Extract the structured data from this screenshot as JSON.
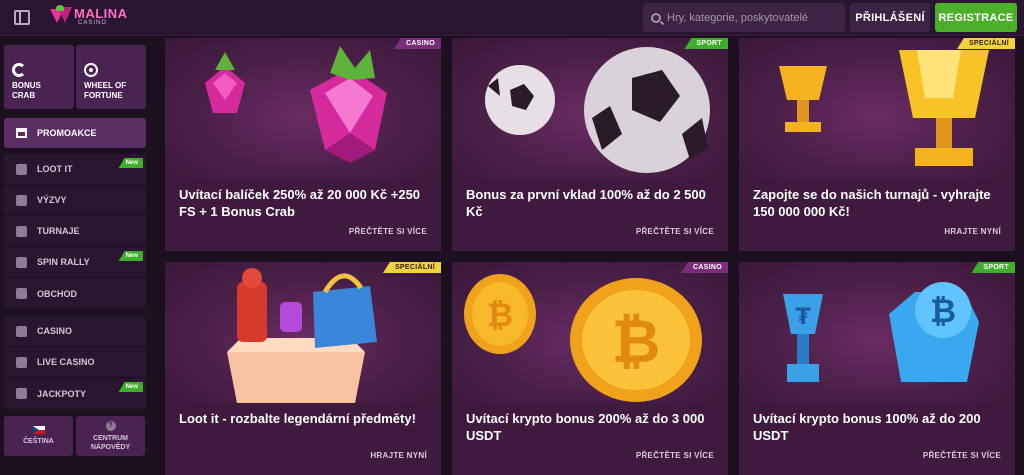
{
  "header": {
    "logo_main": "MALINA",
    "logo_sub": "CASINO",
    "search_placeholder": "Hry, kategorie, poskytovatelé",
    "login_label": "PŘIHLÁŠENÍ",
    "register_label": "REGISTRACE",
    "accent_color": "#4caf2a"
  },
  "sidebar": {
    "tiles": [
      {
        "label": "BONUS CRAB",
        "icon": "crab-icon"
      },
      {
        "label": "WHEEL OF FORTUNE",
        "icon": "wheel-icon"
      }
    ],
    "promo_label": "PROMOAKCE",
    "group1": [
      {
        "label": "LOOT IT",
        "icon": "chest-icon",
        "badge": "New"
      },
      {
        "label": "VÝZVY",
        "icon": "medal-icon",
        "badge": ""
      },
      {
        "label": "TURNAJE",
        "icon": "trophy-icon",
        "badge": ""
      },
      {
        "label": "SPIN RALLY",
        "icon": "flag-icon",
        "badge": "New"
      },
      {
        "label": "OBCHOD",
        "icon": "shop-icon",
        "badge": ""
      }
    ],
    "group2": [
      {
        "label": "CASINO",
        "icon": "cherry-icon",
        "badge": ""
      },
      {
        "label": "LIVE CASINO",
        "icon": "chip-icon",
        "badge": ""
      },
      {
        "label": "JACKPOTY",
        "icon": "coins-icon",
        "badge": "New"
      }
    ],
    "footer": {
      "language_label": "ČEŠTINA",
      "help_label": "CENTRUM NÁPOVĚDY",
      "help_glyph": "?"
    }
  },
  "cards": [
    {
      "tag": "CASINO",
      "title": "Uvítací balíček 250% až 20 000 Kč +250 FS + 1 Bonus Crab",
      "cta": "PŘEČTĚTE SI VÍCE",
      "art": "raspberry"
    },
    {
      "tag": "SPORT",
      "title": "Bonus za první vklad 100% až do 2 500 Kč",
      "cta": "PŘEČTĚTE SI VÍCE",
      "art": "football"
    },
    {
      "tag": "SPECIÁLNÍ",
      "title": "Zapojte se do našich turnajů - vyhrajte 150 000 000 Kč!",
      "cta": "HRAJTE NYNÍ",
      "art": "trophy"
    },
    {
      "tag": "SPECIÁLNÍ",
      "title": "Loot it - rozbalte legendární předměty!",
      "cta": "HRAJTE NYNÍ",
      "art": "loot"
    },
    {
      "tag": "CASINO",
      "title": "Uvítací krypto bonus 200% až do 3 000 USDT",
      "cta": "PŘEČTĚTE SI VÍCE",
      "art": "bitcoin-coins"
    },
    {
      "tag": "SPORT",
      "title": "Uvítací krypto bonus 100% až do 200 USDT",
      "cta": "PŘEČTĚTE SI VÍCE",
      "art": "crypto-trophies"
    }
  ]
}
